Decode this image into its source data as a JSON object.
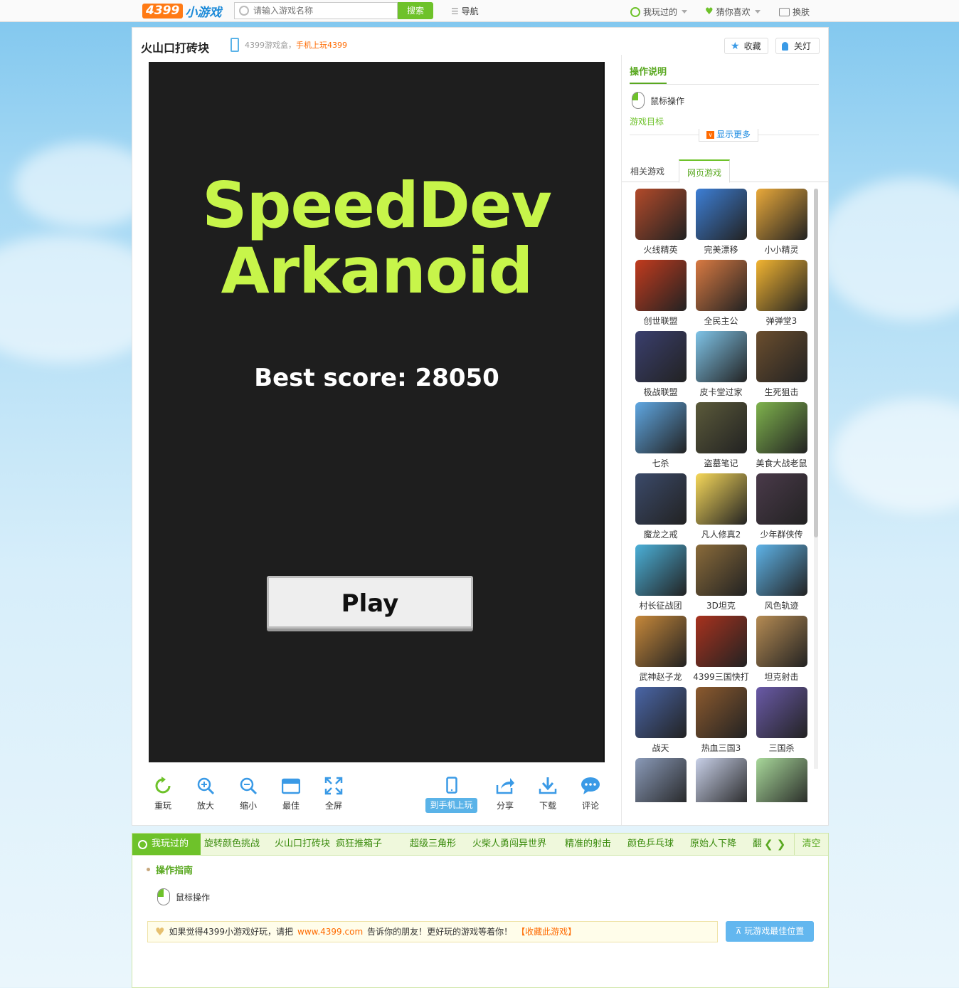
{
  "topbar": {
    "logo_num": "4399",
    "logo_text": "小游戏",
    "search_placeholder": "请输入游戏名称",
    "search_button": "搜索",
    "nav_label": "导航",
    "played_label": "我玩过的",
    "like_label": "猜你喜欢",
    "skin_label": "换肤"
  },
  "header": {
    "game_title": "火山口打砖块",
    "promo_text": "4399游戏盒，",
    "promo_highlight": "手机上玩4399",
    "favorite_label": "收藏",
    "lights_label": "关灯"
  },
  "game": {
    "title_line1": "SpeedDev",
    "title_line2": "Arkanoid",
    "best_score": "Best score: 28050",
    "play_label": "Play",
    "title_color": "#c7f54a",
    "bg_color": "#1e1e1e"
  },
  "toolbar": {
    "replay": "重玩",
    "zoom_in": "放大",
    "zoom_out": "缩小",
    "best_size": "最佳",
    "fullscreen": "全屏",
    "to_mobile": "到手机上玩",
    "share": "分享",
    "download": "下载",
    "comment": "评论"
  },
  "sidebar": {
    "howto_title": "操作说明",
    "mouse_label": "鼠标操作",
    "goal_label": "游戏目标",
    "more_label": "显示更多",
    "tab_related": "相关游戏",
    "tab_web": "网页游戏",
    "games": [
      {
        "name": "火线精英",
        "color": "#b24a2a"
      },
      {
        "name": "完美漂移",
        "color": "#3d7fd6"
      },
      {
        "name": "小小精灵",
        "color": "#e9a93a"
      },
      {
        "name": "创世联盟",
        "color": "#c23b1e"
      },
      {
        "name": "全民主公",
        "color": "#d97a42"
      },
      {
        "name": "弹弹堂3",
        "color": "#f2b431"
      },
      {
        "name": "极战联盟",
        "color": "#3a3f6e"
      },
      {
        "name": "皮卡堂过家",
        "color": "#7fc4e8"
      },
      {
        "name": "生死狙击",
        "color": "#6b4e2e"
      },
      {
        "name": "七杀",
        "color": "#5fa7e2"
      },
      {
        "name": "盗墓笔记",
        "color": "#5b5a3a"
      },
      {
        "name": "美食大战老鼠",
        "color": "#7fb34d"
      },
      {
        "name": "魔龙之戒",
        "color": "#3b4a6a"
      },
      {
        "name": "凡人修真2",
        "color": "#f6d85a"
      },
      {
        "name": "少年群侠传",
        "color": "#4a3a4a"
      },
      {
        "name": "村长征战团",
        "color": "#4bb0d8"
      },
      {
        "name": "3D坦克",
        "color": "#8a6b3a"
      },
      {
        "name": "风色轨迹",
        "color": "#5eb3e8"
      },
      {
        "name": "武神赵子龙",
        "color": "#c6883a"
      },
      {
        "name": "4399三国快打",
        "color": "#a8321e"
      },
      {
        "name": "坦克射击",
        "color": "#b58b53"
      },
      {
        "name": "战天",
        "color": "#4a66a8"
      },
      {
        "name": "热血三国3",
        "color": "#8c5a2e"
      },
      {
        "name": "三国杀",
        "color": "#6a5aa8"
      },
      {
        "name": "",
        "color": "#8a9ab8"
      },
      {
        "name": "",
        "color": "#c8d0e8"
      },
      {
        "name": "",
        "color": "#a8d89a"
      }
    ]
  },
  "played_bar": {
    "label": "我玩过的",
    "items": [
      "旋转颜色挑战",
      "火山口打砖块",
      "疯狂推箱子",
      "超级三角形",
      "火柴人勇闯异世界",
      "精准的射击",
      "颜色乒乓球",
      "原始人下降",
      "翻"
    ],
    "arrows": "❮ ❯",
    "clear": "清空"
  },
  "bottom": {
    "guide_title": "操作指南",
    "mouse_label": "鼠标操作",
    "share_text1": "如果觉得4399小游戏好玩，请把",
    "share_url": "www.4399.com",
    "share_text2": "告诉你的朋友！更好玩的游戏等着你！",
    "share_fav": "【收藏此游戏】",
    "best_position": "玩游戏最佳位置"
  }
}
